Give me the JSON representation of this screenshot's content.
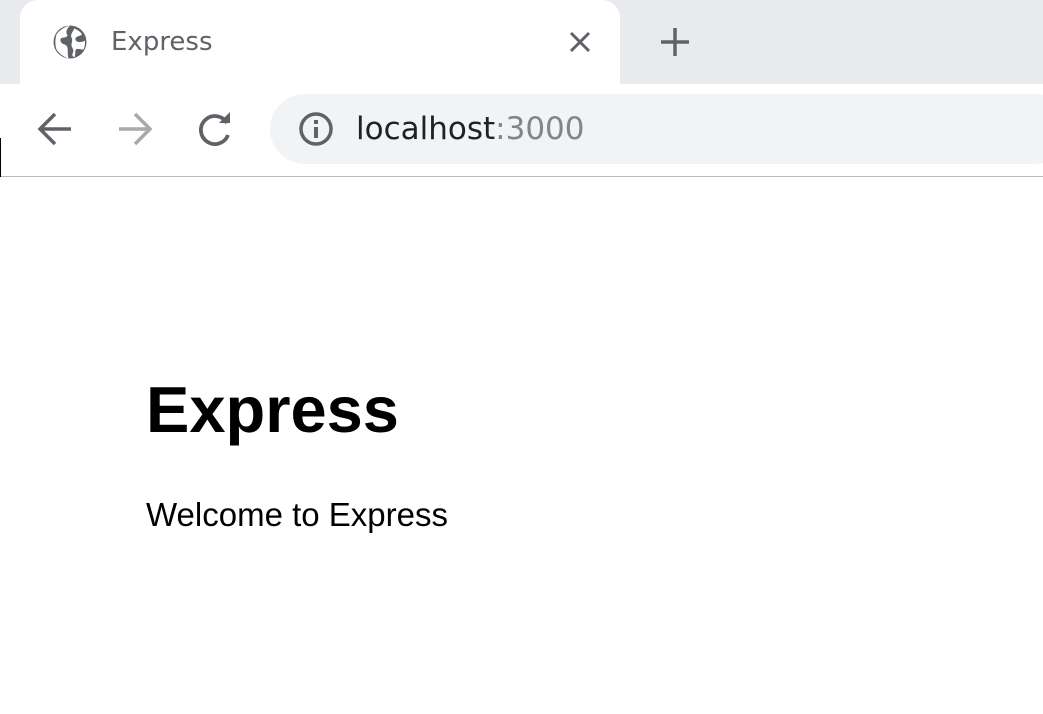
{
  "tab": {
    "title": "Express",
    "favicon": "globe-icon"
  },
  "omnibox": {
    "host": "localhost",
    "port": ":3000"
  },
  "page": {
    "heading": "Express",
    "text": "Welcome to Express"
  },
  "colors": {
    "tab_strip": "#e8eaed",
    "omnibox_bg": "#f1f3f4",
    "icon_gray": "#5f6368",
    "disabled_gray": "#a7a9ab",
    "port_gray": "#80868b"
  }
}
